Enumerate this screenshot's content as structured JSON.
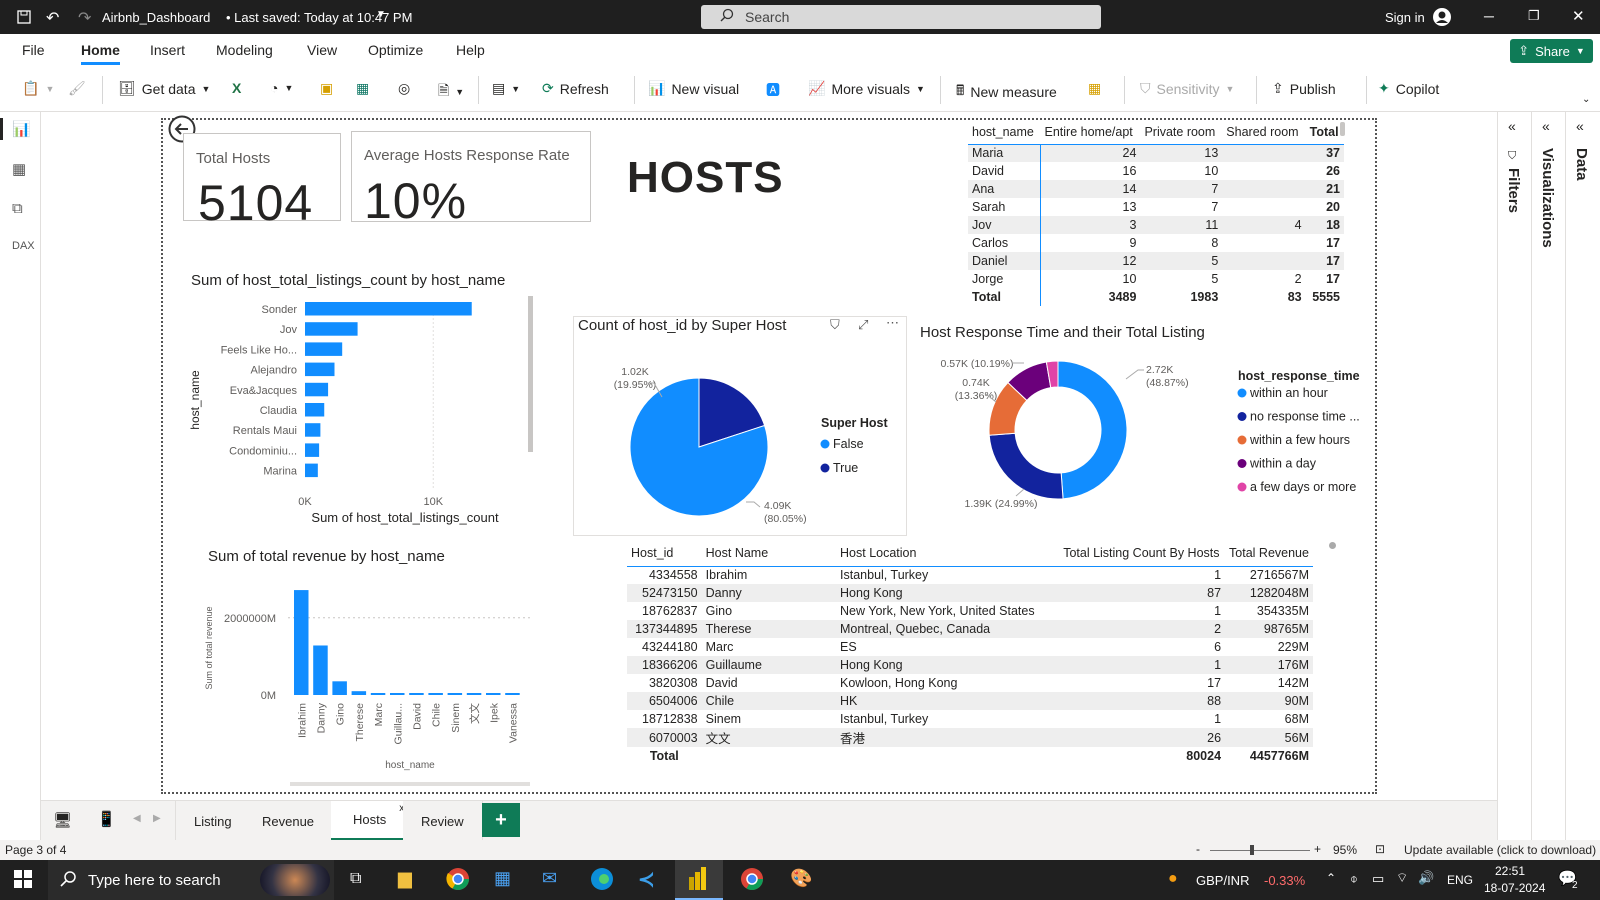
{
  "titlebar": {
    "file_title": "Airbnb_Dashboard",
    "saved": "• Last saved: Today at 10:47 PM",
    "search_placeholder": "Search",
    "sign_in": "Sign in"
  },
  "menu": [
    "File",
    "Home",
    "Insert",
    "Modeling",
    "View",
    "Optimize",
    "Help"
  ],
  "share": "Share",
  "ribbon": {
    "get_data": "Get data",
    "refresh": "Refresh",
    "new_visual": "New visual",
    "more_visuals": "More visuals",
    "new_measure": "New measure",
    "sensitivity": "Sensitivity",
    "publish": "Publish",
    "copilot": "Copilot"
  },
  "panes": {
    "filters": "Filters",
    "visualizations": "Visualizations",
    "data": "Data"
  },
  "cards": {
    "total_hosts_label": "Total Hosts",
    "total_hosts_value": "5104",
    "response_rate_label": "Average Hosts Response Rate",
    "response_rate_value": "10%"
  },
  "page_title": "HOSTS",
  "matrix": {
    "headers": [
      "host_name",
      "Entire home/apt",
      "Private room",
      "Shared room",
      "Total"
    ],
    "rows": [
      [
        "Maria",
        "24",
        "13",
        "",
        "37"
      ],
      [
        "David",
        "16",
        "10",
        "",
        "26"
      ],
      [
        "Ana",
        "14",
        "7",
        "",
        "21"
      ],
      [
        "Sarah",
        "13",
        "7",
        "",
        "20"
      ],
      [
        "Jov",
        "3",
        "11",
        "4",
        "18"
      ],
      [
        "Carlos",
        "9",
        "8",
        "",
        "17"
      ],
      [
        "Daniel",
        "12",
        "5",
        "",
        "17"
      ],
      [
        "Jorge",
        "10",
        "5",
        "2",
        "17"
      ]
    ],
    "total": [
      "Total",
      "3489",
      "1983",
      "83",
      "5555"
    ]
  },
  "chart_data": [
    {
      "type": "bar",
      "orientation": "horizontal",
      "title": "Sum of host_total_listings_count by host_name",
      "xlabel": "Sum of host_total_listings_count",
      "ylabel": "host_name",
      "categories": [
        "Sonder",
        "Jov",
        "Feels Like Ho...",
        "Alejandro",
        "Eva&Jacques",
        "Claudia",
        "Rentals Maui",
        "Condominiu...",
        "Marina"
      ],
      "values": [
        13000,
        4100,
        2900,
        2300,
        1800,
        1500,
        1200,
        1100,
        1000
      ],
      "xlim": [
        0,
        16000
      ],
      "xticks": [
        "0K",
        "10K"
      ],
      "color": "#118dff"
    },
    {
      "type": "pie",
      "title": "Count of host_id by Super Host",
      "legend_title": "Super Host",
      "categories": [
        "False",
        "True"
      ],
      "values": [
        4090,
        1020
      ],
      "labels": [
        "4.09K\n(80.05%)",
        "1.02K\n(19.95%)"
      ],
      "colors": [
        "#118dff",
        "#12239e"
      ]
    },
    {
      "type": "pie",
      "variant": "donut",
      "title": "Host Response Time and their Total Listing",
      "legend_title": "host_response_time",
      "categories": [
        "within an hour",
        "no response time ...",
        "within a few hours",
        "within a day",
        "a few days or more"
      ],
      "values": [
        2720,
        1390,
        740,
        570,
        150
      ],
      "labels": [
        "2.72K (48.87%)",
        "1.39K (24.99%)",
        "0.74K (13.36%)",
        "0.57K (10.19%)",
        ""
      ],
      "colors": [
        "#118dff",
        "#12239e",
        "#e66c37",
        "#6b007b",
        "#e044a7"
      ]
    },
    {
      "type": "bar",
      "orientation": "vertical",
      "title": "Sum of total revenue by host_name",
      "xlabel": "host_name",
      "ylabel": "Sum of total revenue",
      "categories": [
        "Ibrahim",
        "Danny",
        "Gino",
        "Therese",
        "Marc",
        "Guillau...",
        "David",
        "Chile",
        "Sinem",
        "文文",
        "Ipek",
        "Vanessa"
      ],
      "values": [
        2716567,
        1282048,
        354335,
        98765,
        229,
        176,
        142,
        90,
        68,
        56,
        40,
        30
      ],
      "yticks": [
        "0M",
        "2000000M"
      ],
      "ylim": [
        0,
        2900000
      ],
      "color": "#118dff"
    }
  ],
  "revenue_table": {
    "headers": [
      "Host_id",
      "Host Name",
      "Host Location",
      "Total Listing Count By Hosts",
      "Total Revenue"
    ],
    "rows": [
      [
        "4334558",
        "Ibrahim",
        "Istanbul, Turkey",
        "1",
        "2716567M"
      ],
      [
        "52473150",
        "Danny",
        "Hong Kong",
        "87",
        "1282048M"
      ],
      [
        "18762837",
        "Gino",
        "New York, New York, United States",
        "1",
        "354335M"
      ],
      [
        "137344895",
        "Therese",
        "Montreal, Quebec, Canada",
        "2",
        "98765M"
      ],
      [
        "43244180",
        "Marc",
        "ES",
        "6",
        "229M"
      ],
      [
        "18366206",
        "Guillaume",
        "Hong Kong",
        "1",
        "176M"
      ],
      [
        "3820308",
        "David",
        "Kowloon, Hong Kong",
        "17",
        "142M"
      ],
      [
        "6504006",
        "Chile",
        "HK",
        "88",
        "90M"
      ],
      [
        "18712838",
        "Sinem",
        "Istanbul, Turkey",
        "1",
        "68M"
      ],
      [
        "6070003",
        "文文",
        "香港",
        "26",
        "56M"
      ]
    ],
    "total": [
      "Total",
      "",
      "",
      "80024",
      "4457766M"
    ]
  },
  "tabs": [
    "Listing",
    "Revenue",
    "Hosts",
    "Review"
  ],
  "active_tab": "Hosts",
  "status": {
    "page": "Page 3 of 4",
    "zoom": "95%",
    "update": "Update available (click to download)"
  },
  "taskbar": {
    "search_placeholder": "Type here to search",
    "currency": "GBP/INR",
    "currency_change": "-0.33%",
    "lang": "ENG",
    "time": "22:51",
    "date": "18-07-2024",
    "notif": "2"
  }
}
